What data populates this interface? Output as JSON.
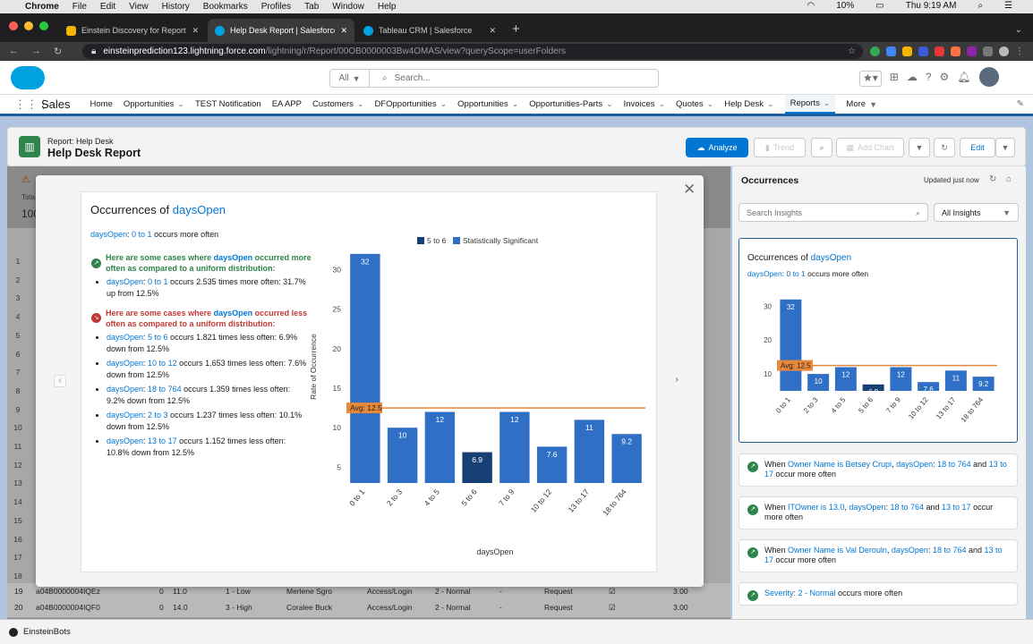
{
  "menubar": {
    "apple": "",
    "app": "Chrome",
    "items": [
      "File",
      "Edit",
      "View",
      "History",
      "Bookmarks",
      "Profiles",
      "Tab",
      "Window",
      "Help"
    ],
    "battery": "10%",
    "clock": "Thu 9:19 AM"
  },
  "tabs": [
    {
      "title": "Einstein Discovery for Reports",
      "color": "#f4b400"
    },
    {
      "title": "Help Desk Report | Salesforce",
      "color": "#00a1e0"
    },
    {
      "title": "Tableau CRM | Salesforce",
      "color": "#00a1e0"
    }
  ],
  "url": {
    "host": "einsteinprediction123.lightning.force.com",
    "path": "/lightning/r/Report/00OB0000003Bw4OMAS/view?queryScope=userFolders"
  },
  "header": {
    "search_scope": "All",
    "search_placeholder": "Search..."
  },
  "nav": {
    "app_name": "Sales",
    "items": [
      {
        "label": "Home",
        "chev": false
      },
      {
        "label": "Opportunities",
        "chev": true
      },
      {
        "label": "TEST Notification",
        "chev": false
      },
      {
        "label": "EA APP",
        "chev": false
      },
      {
        "label": "Customers",
        "chev": true
      },
      {
        "label": "DFOpportunities",
        "chev": true
      },
      {
        "label": "Opportunities",
        "chev": true
      },
      {
        "label": "Opportunities-Parts",
        "chev": true
      },
      {
        "label": "Invoices",
        "chev": true
      },
      {
        "label": "Quotes",
        "chev": true
      },
      {
        "label": "Help Desk",
        "chev": true
      },
      {
        "label": "Reports",
        "chev": true,
        "active": true
      },
      {
        "label": "More",
        "chev": true
      }
    ]
  },
  "report": {
    "kicker": "Report: Help Desk",
    "title": "Help Desk Report",
    "analyze": "Analyze",
    "trend": "Trend",
    "add_chart": "Add Chart",
    "edit": "Edit",
    "tot_label": "Tota",
    "tot_value": "100"
  },
  "modal": {
    "title_prefix": "Occurrences of ",
    "field": "daysOpen",
    "subtitle_field": "daysOpen",
    "subtitle_range": "0 to 1",
    "subtitle_rest": " occurs more often",
    "more_head_pre": "Here are some cases where ",
    "more_head_field": "daysOpen",
    "more_head_post": " occurred more often as compared to a uniform distribution:",
    "more_items": [
      {
        "field": "daysOpen",
        "range": "0 to 1",
        "text": " occurs 2.535 times more often: 31.7% up from 12.5%"
      }
    ],
    "less_head_pre": "Here are some cases where ",
    "less_head_field": "daysOpen",
    "less_head_post": " occurred less often as compared to a uniform distribution:",
    "less_items": [
      {
        "field": "daysOpen",
        "range": "5 to 6",
        "text": " occurs 1.821 times less often: 6.9% down from 12.5%"
      },
      {
        "field": "daysOpen",
        "range": "10 to 12",
        "text": " occurs 1.653 times less often: 7.6% down from 12.5%"
      },
      {
        "field": "daysOpen",
        "range": "18 to 764",
        "text": " occurs 1.359 times less often: 9.2% down from 12.5%"
      },
      {
        "field": "daysOpen",
        "range": "2 to 3",
        "text": " occurs 1.237 times less often: 10.1% down from 12.5%"
      },
      {
        "field": "daysOpen",
        "range": "13 to 17",
        "text": " occurs 1.152 times less often: 10.8% down from 12.5%"
      }
    ]
  },
  "chart_data": [
    {
      "type": "bar",
      "categories": [
        "0 to 1",
        "2 to 3",
        "4 to 5",
        "5 to 6",
        "7 to 9",
        "10 to 12",
        "13 to 17",
        "18 to 764"
      ],
      "values": [
        32,
        10,
        12,
        6.9,
        12,
        7.6,
        11,
        9.2
      ],
      "highlight_index": 3,
      "avg": 12.5,
      "avg_label": "Avg: 12.5",
      "legend": [
        "5 to 6",
        "Statistically Significant"
      ],
      "colors": {
        "bar": "#2f6fc6",
        "highlight": "#173f73",
        "avg": "#e8883a"
      },
      "xlabel": "daysOpen",
      "ylabel": "Rate of Occurrence",
      "yticks": [
        5,
        10,
        15,
        20,
        25,
        30
      ],
      "ylim": [
        3,
        33
      ]
    },
    {
      "type": "bar",
      "categories": [
        "0 to 1",
        "2 to 3",
        "4 to 5",
        "5 to 6",
        "7 to 9",
        "10 to 12",
        "13 to 17",
        "18 to 764"
      ],
      "values": [
        32,
        10,
        12,
        6.9,
        12,
        7.6,
        11,
        9.2
      ],
      "highlight_index": 3,
      "avg": 12.5,
      "avg_label": "Avg: 12.5",
      "colors": {
        "bar": "#2f6fc6",
        "highlight": "#173f73",
        "avg": "#e8883a"
      },
      "yticks": [
        10,
        20,
        30
      ],
      "ylim": [
        5,
        33
      ]
    }
  ],
  "side": {
    "title": "Occurrences",
    "updated": "Updated just now",
    "search_placeholder": "Search Insights",
    "filter": "All Insights",
    "card_title_prefix": "Occurrences of ",
    "card_field": "daysOpen",
    "card_sub_field": "daysOpen",
    "card_sub_range": "0 to 1",
    "card_sub_rest": " occurs more often",
    "insights": [
      {
        "a": "When ",
        "b": "Owner Name is Betsey Crupi",
        "c": ", ",
        "d": "daysOpen",
        "e": ": ",
        "f": "18 to 764",
        "g": " and ",
        "h": "13 to 17",
        "i": " occur more often"
      },
      {
        "a": "When ",
        "b": "ITOwner is 13.0",
        "c": ", ",
        "d": "daysOpen",
        "e": ": ",
        "f": "18 to 764",
        "g": " and ",
        "h": "13 to 17",
        "i": " occur more often"
      },
      {
        "a": "When ",
        "b": "Owner Name is Val Derouln",
        "c": ", ",
        "d": "daysOpen",
        "e": ": ",
        "f": "18 to 764",
        "g": " and ",
        "h": "13 to 17",
        "i": " occur more often"
      },
      {
        "a": "",
        "b": "Severity",
        "c": ": ",
        "d": "2 - Normal",
        "e": "",
        "f": "",
        "g": "",
        "h": "",
        "i": " occurs more often"
      }
    ]
  },
  "row_numbers": [
    "1",
    "2",
    "3",
    "4",
    "5",
    "6",
    "7",
    "8",
    "9",
    "10",
    "11",
    "12",
    "13",
    "14",
    "15",
    "16",
    "17",
    "18"
  ],
  "rows": [
    {
      "n": "19",
      "id": "a04B0000004IQEz",
      "c1": "0",
      "c2": "11.0",
      "sev": "1 - Low",
      "owner": "Merlene Sgro",
      "cat": "Access/Login",
      "pri": "2 - Normal",
      "dash": "-",
      "type": "Request",
      "val": "3.00"
    },
    {
      "n": "20",
      "id": "a04B0000004IQF0",
      "c1": "0",
      "c2": "14.0",
      "sev": "3 - High",
      "owner": "Coralee Buck",
      "cat": "Access/Login",
      "pri": "2 - Normal",
      "dash": "-",
      "type": "Request",
      "val": "3.00"
    }
  ],
  "footer": {
    "label": "EinsteinBots"
  }
}
